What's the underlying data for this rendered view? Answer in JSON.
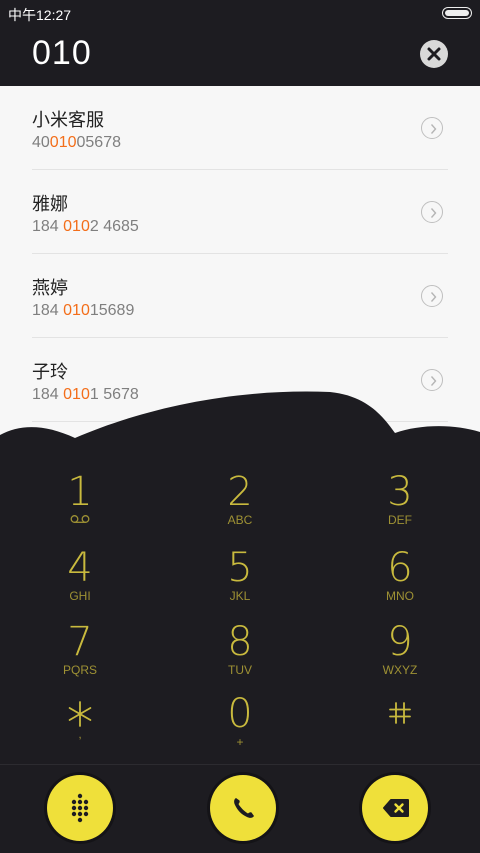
{
  "status_bar": {
    "time": "中午12:27"
  },
  "dialer": {
    "number": "010"
  },
  "contacts": [
    {
      "name": "小米客服",
      "num_pre": "40",
      "num_hl": "010",
      "num_post": "05678"
    },
    {
      "name": "雅娜",
      "num_pre": "184 ",
      "num_hl": "010",
      "num_post": "2 4685"
    },
    {
      "name": "燕婷",
      "num_pre": "184 ",
      "num_hl": "010",
      "num_post": "15689"
    },
    {
      "name": "子玲",
      "num_pre": "184 ",
      "num_hl": "010",
      "num_post": "1 5678"
    }
  ],
  "keys": [
    {
      "digit": "1",
      "letters": ""
    },
    {
      "digit": "2",
      "letters": "ABC"
    },
    {
      "digit": "3",
      "letters": "DEF"
    },
    {
      "digit": "4",
      "letters": "GHI"
    },
    {
      "digit": "5",
      "letters": "JKL"
    },
    {
      "digit": "6",
      "letters": "MNO"
    },
    {
      "digit": "7",
      "letters": "PQRS"
    },
    {
      "digit": "8",
      "letters": "TUV"
    },
    {
      "digit": "9",
      "letters": "WXYZ"
    },
    {
      "digit": "",
      "letters": ","
    },
    {
      "digit": "0",
      "letters": "+"
    },
    {
      "digit": "",
      "letters": ""
    }
  ],
  "colors": {
    "accent_yellow": "#efe03a",
    "key_gold": "#c9ba3e",
    "highlight_orange": "#f36e1a",
    "background_dark": "#1d1c21",
    "list_bg": "#f7f7f7"
  },
  "icons": {
    "voicemail": "voicemail-icon",
    "star": "asterisk-icon",
    "hash": "hash-icon",
    "clear": "clear-x-icon",
    "arrow": "chevron-right-icon",
    "dialpad": "dialpad-icon",
    "call": "phone-icon",
    "backspace": "backspace-icon"
  }
}
